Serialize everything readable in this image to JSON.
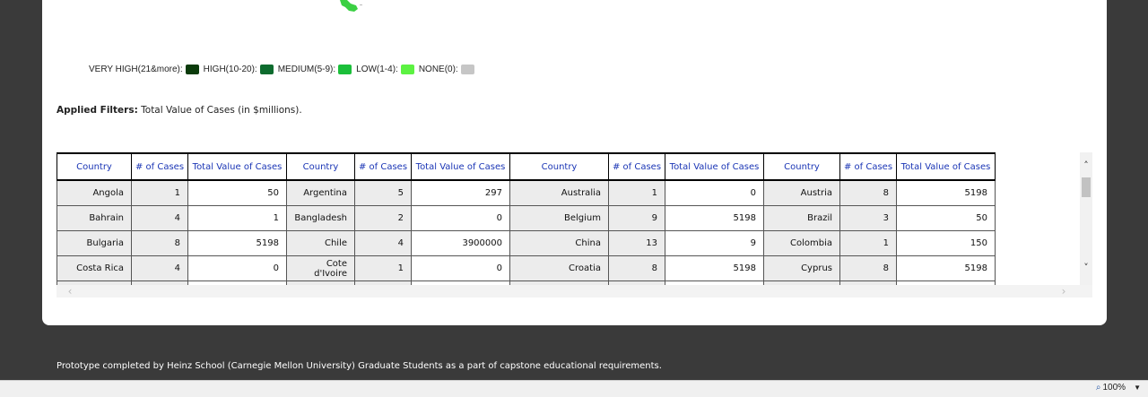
{
  "legend": [
    {
      "label": "VERY HIGH(21&more):",
      "color": "#0b3b0b"
    },
    {
      "label": "HIGH(10-20):",
      "color": "#0d6b2e"
    },
    {
      "label": "MEDIUM(5-9):",
      "color": "#1bbf3a"
    },
    {
      "label": "LOW(1-4):",
      "color": "#5cf242"
    },
    {
      "label": "NONE(0):",
      "color": "#c6c6c6"
    }
  ],
  "filters": {
    "label": "Applied Filters:",
    "value": "Total Value of Cases (in $millions)."
  },
  "table": {
    "headers": [
      "Country",
      "# of Cases",
      "Total Value of Cases",
      "Country",
      "# of Cases",
      "Total Value of Cases",
      "Country",
      "# of Cases",
      "Total Value of Cases",
      "Country",
      "# of Cases",
      "Total Value of Cases"
    ],
    "rows": [
      [
        "Angola",
        "1",
        "50",
        "Argentina",
        "5",
        "297",
        "Australia",
        "1",
        "0",
        "Austria",
        "8",
        "5198"
      ],
      [
        "Bahrain",
        "4",
        "1",
        "Bangladesh",
        "2",
        "0",
        "Belgium",
        "9",
        "5198",
        "Brazil",
        "3",
        "50"
      ],
      [
        "Bulgaria",
        "8",
        "5198",
        "Chile",
        "4",
        "3900000",
        "China",
        "13",
        "9",
        "Colombia",
        "1",
        "150"
      ],
      [
        "Costa Rica",
        "4",
        "0",
        "Cote d'Ivoire",
        "1",
        "0",
        "Croatia",
        "8",
        "5198",
        "Cyprus",
        "8",
        "5198"
      ],
      [
        "",
        "",
        "",
        "",
        "",
        "",
        "",
        "",
        "",
        "",
        "",
        ""
      ]
    ]
  },
  "footer": "Prototype completed by Heinz School (Carnegie Mellon University) Graduate Students as a part of capstone educational requirements.",
  "statusbar": {
    "zoom": "100%"
  }
}
